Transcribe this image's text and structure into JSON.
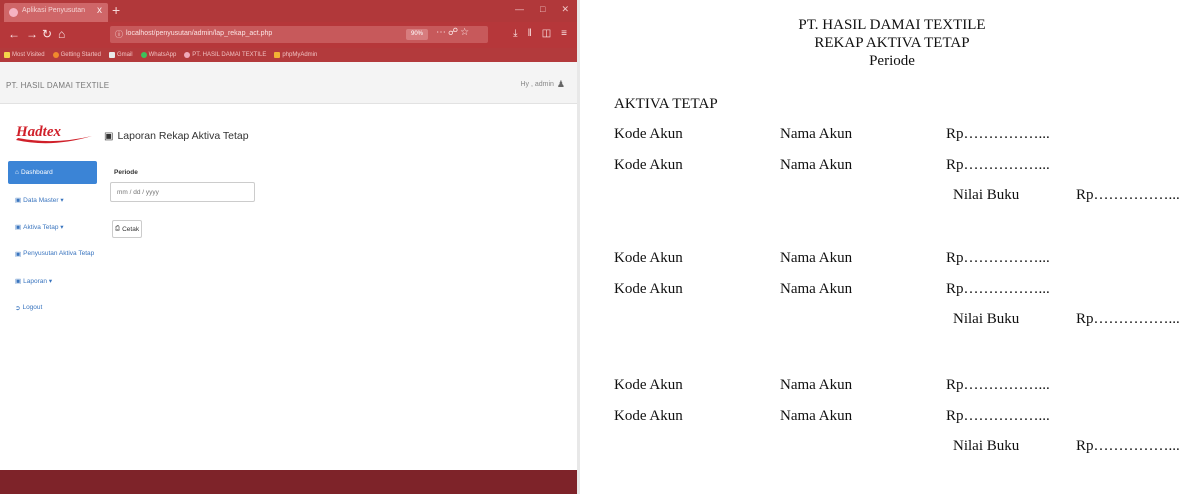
{
  "browser": {
    "tab_title": "Aplikasi Penyusutan",
    "tab_close": "x",
    "new_tab": "+",
    "url": "localhost/penyusutan/admin/lap_rekap_act.php",
    "zoom": "90%",
    "bookmarks": [
      "Most Visited",
      "Getting Started",
      "Gmail",
      "WhatsApp",
      "PT. HASIL DAMAI TEXTILE",
      "phpMyAdmin"
    ]
  },
  "app": {
    "brand": "PT. HASIL DAMAI TEXTILE",
    "greeting": "Hy , admin",
    "logo_text": "Hadtex",
    "page_title": "Laporan Rekap Aktiva Tetap",
    "sidebar": [
      {
        "label": "Dashboard",
        "active": true
      },
      {
        "label": "Data Master ▾",
        "active": false
      },
      {
        "label": "Aktiva Tetap ▾",
        "active": false
      },
      {
        "label": "Penyusutan Aktiva Tetap",
        "active": false
      },
      {
        "label": "Laporan ▾",
        "active": false
      },
      {
        "label": "Logout",
        "active": false
      }
    ],
    "form": {
      "label": "Periode",
      "placeholder": "mm / dd / yyyy",
      "button": "Cetak"
    }
  },
  "report": {
    "company": "PT. HASIL DAMAI TEXTILE",
    "title": "REKAP AKTIVA TETAP",
    "period": "Periode",
    "section": "AKTIVA TETAP",
    "groups": [
      {
        "rows": [
          {
            "kode": "Kode Akun",
            "nama": "Nama Akun",
            "rp": "Rp……………..."
          },
          {
            "kode": "Kode Akun",
            "nama": "Nama Akun",
            "rp": "Rp……………..."
          }
        ],
        "nilai_label": "Nilai Buku",
        "nilai_value": "Rp……………..."
      },
      {
        "rows": [
          {
            "kode": "Kode Akun",
            "nama": "Nama Akun",
            "rp": "Rp……………..."
          },
          {
            "kode": "Kode Akun",
            "nama": "Nama Akun",
            "rp": "Rp……………..."
          }
        ],
        "nilai_label": "Nilai Buku",
        "nilai_value": "Rp……………..."
      },
      {
        "rows": [
          {
            "kode": "Kode Akun",
            "nama": "Nama Akun",
            "rp": "Rp……………..."
          },
          {
            "kode": "Kode Akun",
            "nama": "Nama Akun",
            "rp": "Rp……………..."
          }
        ],
        "nilai_label": "Nilai Buku",
        "nilai_value": "Rp……………..."
      }
    ]
  },
  "colors": {
    "titlebar": "#b1383a",
    "sidebar_active": "#3b84d6",
    "link": "#3a75bf",
    "footer": "#7e2329",
    "logo": "#d0202a"
  }
}
